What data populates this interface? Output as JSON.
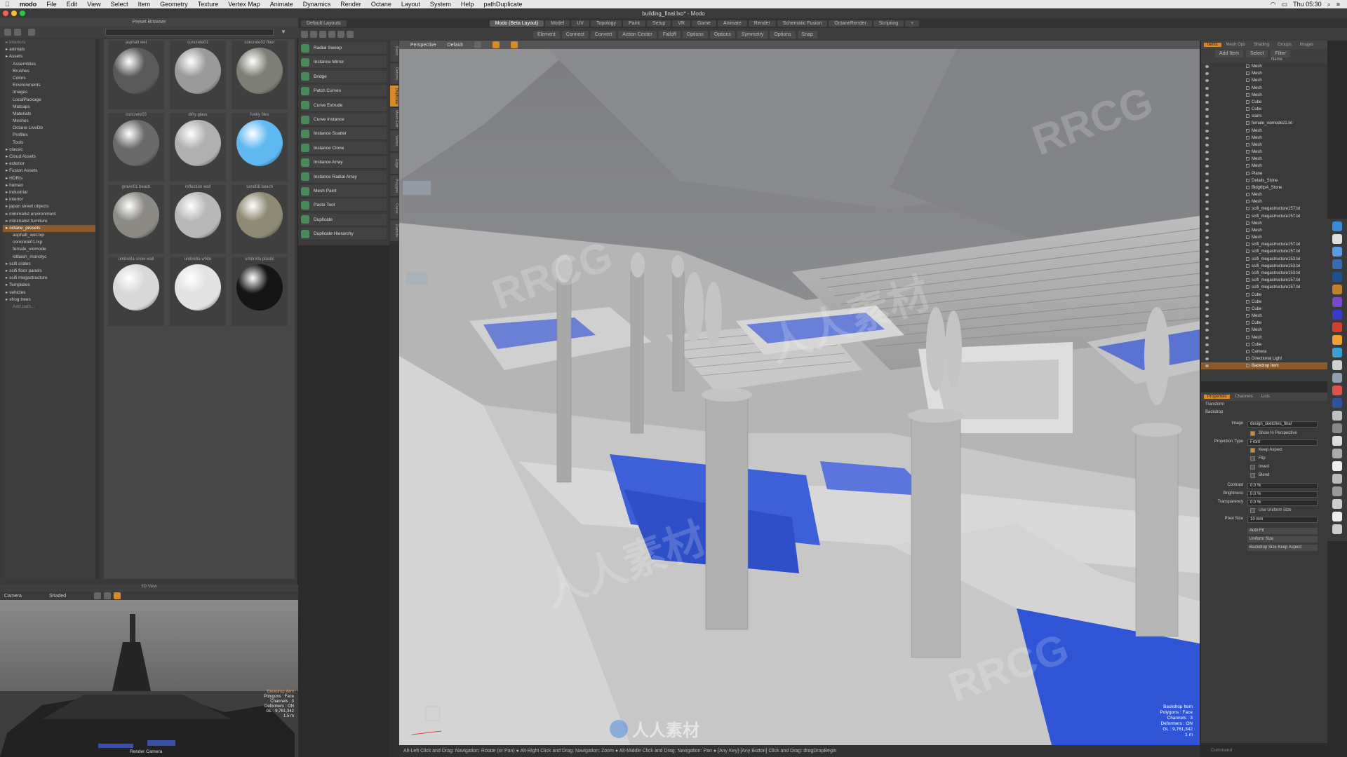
{
  "menubar": {
    "app": "modo",
    "items": [
      "File",
      "Edit",
      "View",
      "Select",
      "Item",
      "Geometry",
      "Texture",
      "Vertex Map",
      "Animate",
      "Dynamics",
      "Render",
      "Octane",
      "Layout",
      "System",
      "Help",
      "pathDuplicate"
    ],
    "clock": "Thu 05:30"
  },
  "window": {
    "title": "building_final.lxo* - Modo"
  },
  "layout": {
    "selector": "Default Layouts",
    "tabs": [
      "Modo (Beta Layout)",
      "Model",
      "UV",
      "Topology",
      "Paint",
      "Setup",
      "VR",
      "Game",
      "Animate",
      "Render",
      "Schematic Fusion",
      "OctaneRender",
      "Scripting"
    ],
    "active_tab": "Modo (Beta Layout)"
  },
  "toolbar": {
    "buttons": [
      "Element",
      "Connect",
      "Convert",
      "Action Center",
      "Falloff",
      "Options",
      "Options",
      "Symmetry",
      "Options",
      "Snap"
    ]
  },
  "preset_browser": {
    "title": "Preset Browser",
    "tree": [
      {
        "label": "interiors",
        "indent": 0,
        "faint": true
      },
      {
        "label": "animals",
        "indent": 0
      },
      {
        "label": "Assets",
        "indent": 0
      },
      {
        "label": "Assemblies",
        "indent": 1
      },
      {
        "label": "Brushes",
        "indent": 1
      },
      {
        "label": "Colors",
        "indent": 1
      },
      {
        "label": "Environments",
        "indent": 1
      },
      {
        "label": "Images",
        "indent": 1
      },
      {
        "label": "LocalPackage",
        "indent": 1
      },
      {
        "label": "Matcaps",
        "indent": 1
      },
      {
        "label": "Materials",
        "indent": 1
      },
      {
        "label": "Meshes",
        "indent": 1
      },
      {
        "label": "Octane LiveDb",
        "indent": 1
      },
      {
        "label": "Profiles",
        "indent": 1
      },
      {
        "label": "Tools",
        "indent": 1
      },
      {
        "label": "classic",
        "indent": 0
      },
      {
        "label": "Cloud Assets",
        "indent": 0
      },
      {
        "label": "exterior",
        "indent": 0
      },
      {
        "label": "Fusion Assets",
        "indent": 0
      },
      {
        "label": "HDRIs",
        "indent": 0
      },
      {
        "label": "human",
        "indent": 0
      },
      {
        "label": "industrial",
        "indent": 0
      },
      {
        "label": "interior",
        "indent": 0
      },
      {
        "label": "japan street objects",
        "indent": 0
      },
      {
        "label": "minimalist environment",
        "indent": 0
      },
      {
        "label": "minimalist furniture",
        "indent": 0
      },
      {
        "label": "octane_presets",
        "indent": 0,
        "selected": true
      },
      {
        "label": "asphalt_wet.lxp",
        "indent": 1
      },
      {
        "label": "concrete01.lxp",
        "indent": 1
      },
      {
        "label": "female_viomode",
        "indent": 1
      },
      {
        "label": "kitbash_monolyc",
        "indent": 1
      },
      {
        "label": "scifi crates",
        "indent": 0
      },
      {
        "label": "scifi floor panels",
        "indent": 0
      },
      {
        "label": "scifi megastructure",
        "indent": 0
      },
      {
        "label": "Templates",
        "indent": 0
      },
      {
        "label": "vehicles",
        "indent": 0
      },
      {
        "label": "xfrog trees",
        "indent": 0
      },
      {
        "label": "Add path...",
        "indent": 1,
        "faint": true
      }
    ],
    "swatches": [
      {
        "label": "asphalt wet",
        "color": "#5a5a5a"
      },
      {
        "label": "concrete01",
        "color": "#9a9a9a"
      },
      {
        "label": "concrete02 floor",
        "color": "#7d7f76"
      },
      {
        "label": "concrete03",
        "color": "#6a6a6a"
      },
      {
        "label": "dirty glass",
        "color": "#b0b0b0"
      },
      {
        "label": "funky tiles",
        "color": "#5fb8f0"
      },
      {
        "label": "gravel01 beach",
        "color": "#8c8a84"
      },
      {
        "label": "reflection wall",
        "color": "#b8b8b8"
      },
      {
        "label": "sand08 beach",
        "color": "#8e8a74"
      },
      {
        "label": "umbrella snow wall",
        "color": "#d8d8d8"
      },
      {
        "label": "umbrella white",
        "color": "#e2e2e2"
      },
      {
        "label": "umbrella plastic",
        "color": "#151515"
      }
    ]
  },
  "mini_view": {
    "title": "3D View",
    "tabs": [
      "Camera",
      "Shaded"
    ],
    "stats": [
      "Backdrop Item",
      "Polygons : Face",
      "Channels : 3",
      "Deformers : ON",
      "GL : 9,761,342",
      "1.5 m"
    ],
    "footer": "Render Camera"
  },
  "tools": [
    "Radial Sweep",
    "Instance Mirror",
    "Bridge",
    "Patch Curves",
    "Curve Extrude",
    "Curve Instance",
    "Instance Scatter",
    "Instance Clone",
    "Instance Array",
    "Instance Radial Array",
    "Mesh Paint",
    "Paste Tool",
    "Duplicate",
    "Duplicate Hierarchy"
  ],
  "vertical_tabs": [
    "Basic",
    "Deform",
    "Duplicate",
    "Mesh Edit",
    "Vertex",
    "Edge",
    "Polygon",
    "Curve",
    "Particle"
  ],
  "vertical_tab_active": "Duplicate",
  "viewport": {
    "view_type": "Perspective",
    "shading": "Default",
    "stats": [
      "Backdrop Item",
      "Polygons : Face",
      "Channels : 3",
      "Deformers : ON",
      "GL : 9,761,342",
      "1 m"
    ]
  },
  "statusbar": {
    "text": "Alt-Left Click and Drag: Navigation: Rotate (or Pan) ● Alt-Right Click and Drag: Navigation: Zoom ● Alt-Middle Click and Drag: Navigation: Pan ● [Any Key]-[Any Button] Click and Drag: dragDropBegin"
  },
  "items_panel": {
    "tabs": [
      "Items",
      "Mesh Ops",
      "Shading",
      "Groups",
      "Images"
    ],
    "add_item": "Add Item",
    "select": "Select",
    "filter": "Filter",
    "column": "Name",
    "items": [
      "Mesh",
      "Mesh",
      "Mesh",
      "Mesh",
      "Mesh",
      "Cube",
      "Cube",
      "stairs",
      "female_viomode21.lxl",
      "Mesh",
      "Mesh",
      "Mesh",
      "Mesh",
      "Mesh",
      "Mesh",
      "Plane",
      "Details_Stone",
      "Bldg6tpA_Stone",
      "Mesh",
      "Mesh",
      "scifi_megastructure157.lxl",
      "scifi_megastructure157.lxl",
      "Mesh",
      "Mesh",
      "Mesh",
      "scifi_megastructure157.lxl",
      "scifi_megastructure157.lxl",
      "scifi_megastructure153.lxl",
      "scifi_megastructure153.lxl",
      "scifi_megastructure153.lxl",
      "scifi_megastructure157.lxl",
      "scifi_megastructure157.lxl",
      "Cube",
      "Cube",
      "Cube",
      "Mesh",
      "Cube",
      "Mesh",
      "Mesh",
      "Cube",
      "Camera",
      "Directional Light",
      "Backdrop Item"
    ],
    "selected_index": 42
  },
  "properties": {
    "tabs": [
      "Properties",
      "Channels",
      "Lists"
    ],
    "section1": "Transform",
    "section2": "Backdrop",
    "image_label": "Image",
    "image_value": "design_sketches_final",
    "show_in_perspective": "Show In Perspective",
    "projection_type_label": "Projection Type",
    "projection_type": "Front",
    "keep_aspect": "Keep Aspect",
    "flip": "Flip",
    "invert": "Invert",
    "blend": "Blend",
    "contrast_label": "Contrast",
    "contrast": "0.0 %",
    "brightness_label": "Brightness",
    "brightness": "0.0 %",
    "transparency_label": "Transparency",
    "transparency": "0.0 %",
    "uniform_size": "Use Uniform Size",
    "pixel_size_label": "Pixel Size",
    "pixel_size": "10 mm",
    "auto_fit": "Auto Fit",
    "uniform_size_btn": "Uniform Size",
    "backdrop_size_btn": "Backdrop Size Keep Aspect",
    "command": "Command"
  },
  "watermarks": [
    "RRCG",
    "人人素材",
    "RRCG",
    "人人素材",
    "RRCG",
    "RRCG",
    "人人素材",
    "RRCG",
    "人人素材",
    "RRCG"
  ],
  "logo_text": "人人素材"
}
